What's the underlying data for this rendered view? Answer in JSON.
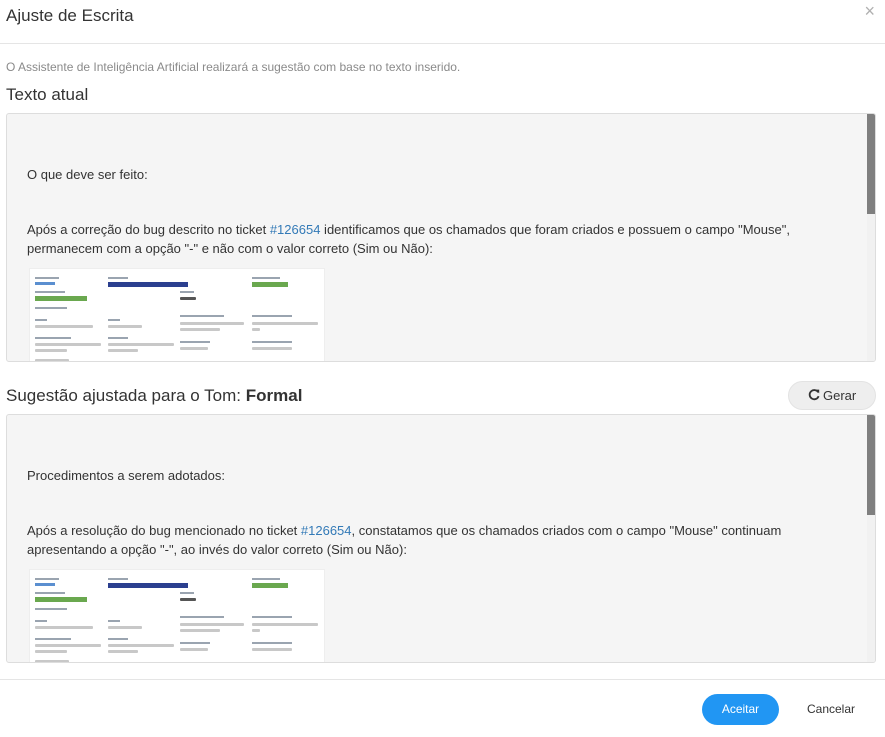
{
  "modal": {
    "title": "Ajuste de Escrita",
    "close_icon": "×",
    "subtitle": "O Assistente de Inteligência Artificial realizará a sugestão com base no texto inserido."
  },
  "current_text": {
    "heading": "Texto atual",
    "para1": "O que deve ser feito:",
    "para2_before": "Após a correção do bug descrito no ticket ",
    "ticket_link": "#126654",
    "para2_after": " identificamos que os chamados que foram criados e possuem o campo \"Mouse\", permanecem com a opção \"-\" e não com o valor correto (Sim ou Não):"
  },
  "suggestion": {
    "heading_prefix": "Sugestão ajustada para o Tom: ",
    "tone": "Formal",
    "generate_icon": "refresh-icon",
    "generate_label": "Gerar",
    "para1": "Procedimentos a serem adotados:",
    "para2_before": "Após a resolução do bug mencionado no ticket ",
    "ticket_link": "#126654",
    "para2_after": ", constatamos que os chamados criados com o campo \"Mouse\" continuam apresentando a opção \"-\", ao invés do valor correto (Sim ou Não):"
  },
  "footer": {
    "accept_label": "Aceitar",
    "cancel_label": "Cancelar"
  },
  "colors": {
    "accent": "#2196f3",
    "link": "#337ab7",
    "panel_bg": "#f5f5f5"
  }
}
